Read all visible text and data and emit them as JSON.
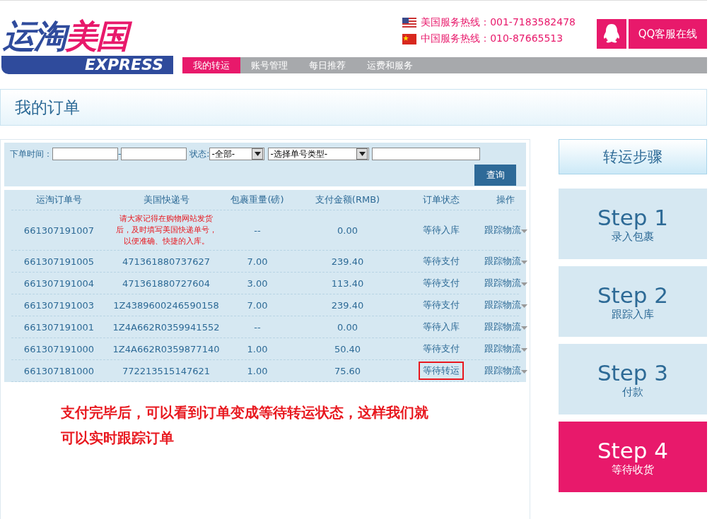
{
  "logo": {
    "word_a": "运淘",
    "word_b": "美国",
    "tagline": "EXPRESS"
  },
  "hotlines": [
    {
      "kind": "us",
      "text": "美国服务热线：001-7183582478"
    },
    {
      "kind": "cn",
      "text": "中国服务热线：010-87665513"
    }
  ],
  "qq_button": "QQ客服在线",
  "nav": [
    {
      "label": "我的转运",
      "selected": true
    },
    {
      "label": "账号管理",
      "selected": false
    },
    {
      "label": "每日推荐",
      "selected": false
    },
    {
      "label": "运费和服务",
      "selected": false
    }
  ],
  "page_title": "我的订单",
  "filter": {
    "date_label": "下单时间：",
    "date_separator": "-",
    "status_label": "状态:",
    "status_value": "-全部-",
    "type_value": "-选择单号类型-",
    "query_button": "查询"
  },
  "table": {
    "columns": [
      "运淘订单号",
      "美国快递号",
      "包裹重量(磅)",
      "支付金额(RMB)",
      "订单状态",
      "操作"
    ],
    "rows": [
      {
        "order": "661307191007",
        "kind": "note",
        "us_tracking": "请大家记得在购物网站发货后，及时填写美国快递单号，以便准确、快捷的入库。",
        "weight": "--",
        "amount": "0.00",
        "status": "等待入库",
        "highlighted": false,
        "action": "跟踪物流"
      },
      {
        "order": "661307191005",
        "kind": "number",
        "us_tracking": "471361880737627",
        "weight": "7.00",
        "amount": "239.40",
        "status": "等待支付",
        "highlighted": false,
        "action": "跟踪物流"
      },
      {
        "order": "661307191004",
        "kind": "number",
        "us_tracking": "471361880727604",
        "weight": "3.00",
        "amount": "113.40",
        "status": "等待支付",
        "highlighted": false,
        "action": "跟踪物流"
      },
      {
        "order": "661307191003",
        "kind": "number",
        "us_tracking": "1Z4389600246590158",
        "weight": "7.00",
        "amount": "239.40",
        "status": "等待支付",
        "highlighted": false,
        "action": "跟踪物流"
      },
      {
        "order": "661307191001",
        "kind": "number",
        "us_tracking": "1Z4A662R0359941552",
        "weight": "--",
        "amount": "0.00",
        "status": "等待入库",
        "highlighted": false,
        "action": "跟踪物流"
      },
      {
        "order": "661307191000",
        "kind": "number",
        "us_tracking": "1Z4A662R0359877140",
        "weight": "1.00",
        "amount": "50.40",
        "status": "等待支付",
        "highlighted": false,
        "action": "跟踪物流"
      },
      {
        "order": "661307181000",
        "kind": "number",
        "us_tracking": "772213515147621",
        "weight": "1.00",
        "amount": "75.60",
        "status": "等待转运",
        "highlighted": true,
        "action": "跟踪物流"
      }
    ]
  },
  "annotation": "支付完毕后，可以看到订单变成等待转运状态，这样我们就可以实时跟踪订单",
  "steps_title": "转运步骤",
  "steps": [
    {
      "title": "Step 1",
      "caption": "录入包裹",
      "selected": false
    },
    {
      "title": "Step 2",
      "caption": "跟踪入库",
      "selected": false
    },
    {
      "title": "Step 3",
      "caption": "付款",
      "selected": false
    },
    {
      "title": "Step 4",
      "caption": "等待收货",
      "selected": true
    }
  ]
}
